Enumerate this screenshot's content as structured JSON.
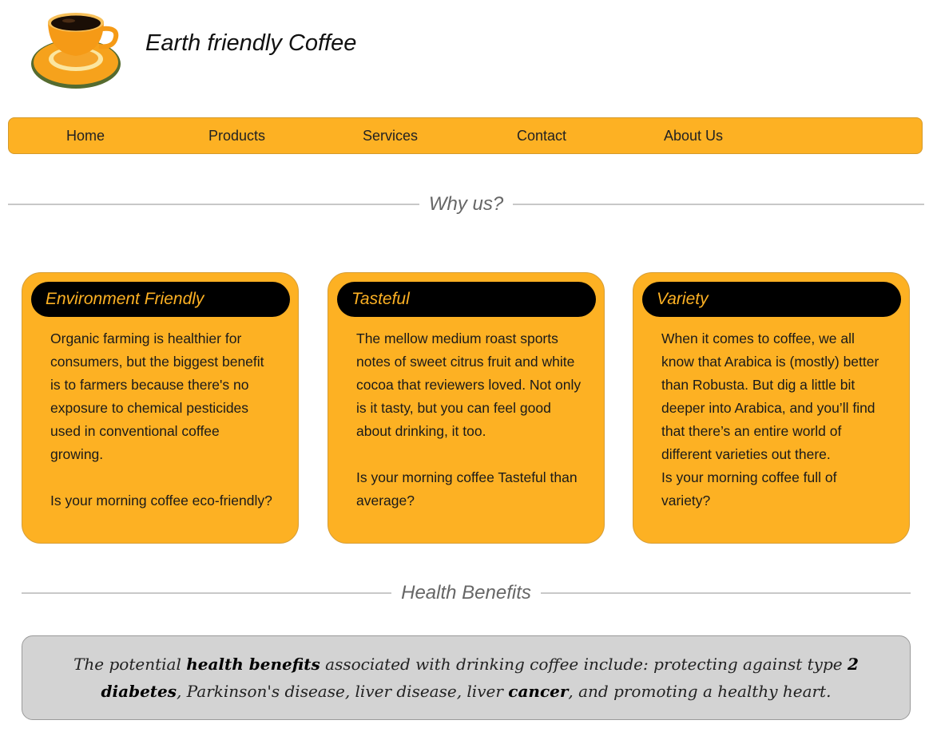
{
  "header": {
    "title": "Earth friendly Coffee",
    "logo_icon": "coffee-cup-icon"
  },
  "nav": {
    "items": [
      {
        "label": "Home"
      },
      {
        "label": "Products"
      },
      {
        "label": "Services"
      },
      {
        "label": "Contact"
      },
      {
        "label": "About Us"
      }
    ]
  },
  "why_us": {
    "heading": "Why us?",
    "cards": [
      {
        "title": "Environment Friendly",
        "body": "Organic farming is healthier for consumers, but the biggest benefit is to farmers because there's no exposure to chemical pesticides used in conventional coffee growing.",
        "question": "Is your morning coffee eco-friendly?"
      },
      {
        "title": "Tasteful",
        "body": "The mellow medium roast sports notes of sweet citrus fruit and white cocoa that reviewers loved. Not only is it tasty, but you can feel good about drinking, it too.",
        "question": "Is your morning coffee Tasteful than average?"
      },
      {
        "title": "Variety",
        "body": "When it comes to coffee, we all know that Arabica is (mostly) better than Robusta. But dig a little bit deeper into Arabica, and you’ll find that there’s an entire world of different varieties out there.",
        "question": "Is your morning coffee full of variety?"
      }
    ]
  },
  "health": {
    "heading": "Health Benefits",
    "text_1": "The potential ",
    "bold_1": "health benefits",
    "text_2": " associated with drinking coffee include: protecting against type ",
    "bold_2": "2 diabetes",
    "text_3": ", Parkinson's disease, liver disease, liver ",
    "bold_3": "cancer",
    "text_4": ", and promoting a healthy heart."
  },
  "colors": {
    "accent": "#fdb123",
    "card_title_bg": "#000000",
    "health_bg": "#d3d3d3"
  }
}
